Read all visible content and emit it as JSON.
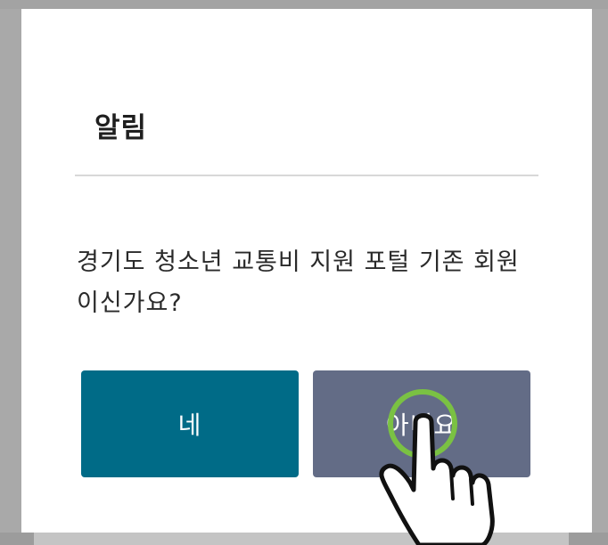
{
  "dialog": {
    "title": "알림",
    "message": "경기도 청소년 교통비 지원 포털 기존 회원이신가요?",
    "yes_label": "네",
    "no_label": "아니요"
  },
  "colors": {
    "yes_button": "#006b87",
    "no_button": "#636c86",
    "tap_ring": "#7ac143"
  },
  "icons": {
    "tap_indicator": "tap-ring-icon",
    "pointer": "hand-pointer-icon"
  }
}
